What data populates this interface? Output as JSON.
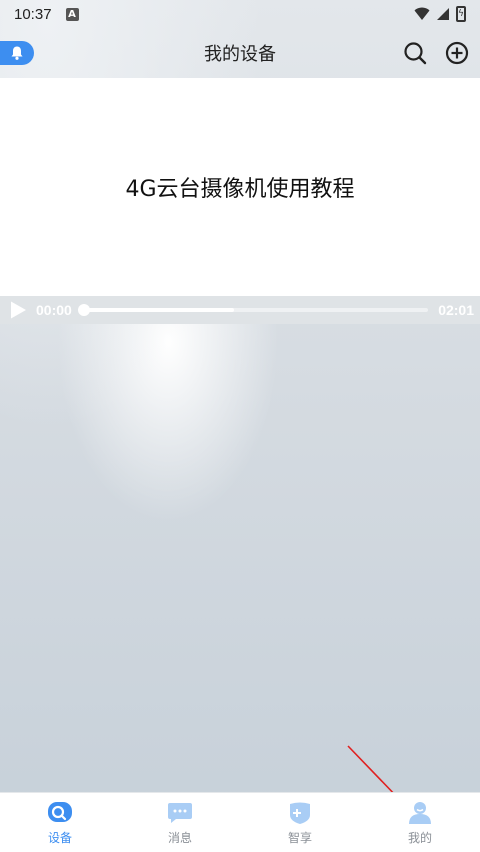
{
  "status_bar": {
    "time": "10:37",
    "notification_glyph": "A",
    "battery_glyph": "ϟ"
  },
  "header": {
    "title": "我的设备"
  },
  "video": {
    "title": "4G云台摄像机使用教程",
    "current_time": "00:00",
    "duration": "02:01",
    "progress_fraction": 0,
    "buffered_fraction": 0.44
  },
  "bottom_nav": {
    "items": [
      {
        "label": "设备",
        "icon": "device-camera-icon",
        "active": true
      },
      {
        "label": "消息",
        "icon": "message-icon",
        "active": false
      },
      {
        "label": "智享",
        "icon": "smart-share-icon",
        "active": false
      },
      {
        "label": "我的",
        "icon": "profile-icon",
        "active": false
      }
    ]
  },
  "colors": {
    "accent": "#3d8ef0",
    "inactive": "#a9cdf5",
    "annotation_arrow": "#e02020"
  }
}
